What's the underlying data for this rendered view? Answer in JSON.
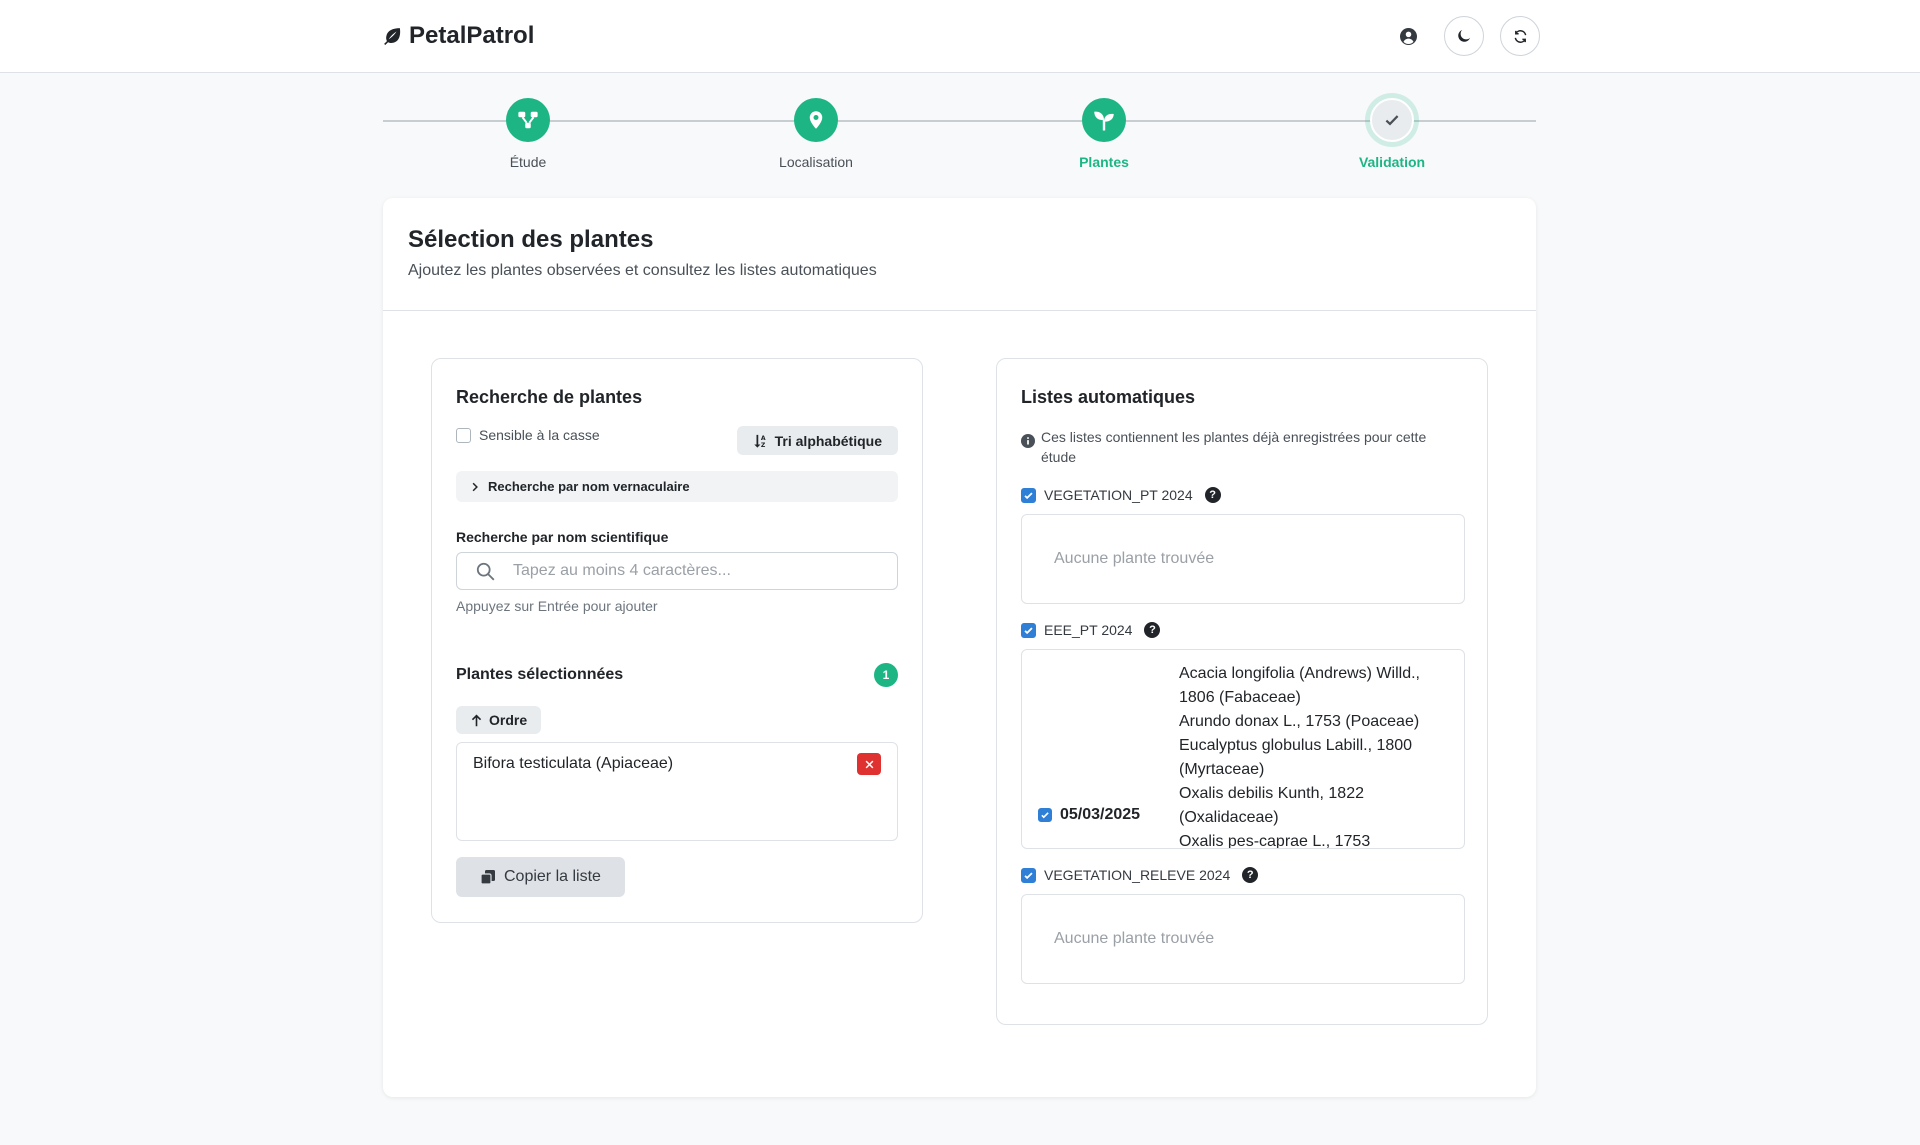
{
  "app": {
    "name": "PetalPatrol"
  },
  "stepper": [
    {
      "label": "Étude",
      "state": "done"
    },
    {
      "label": "Localisation",
      "state": "done"
    },
    {
      "label": "Plantes",
      "state": "active"
    },
    {
      "label": "Validation",
      "state": "active-pending"
    }
  ],
  "page": {
    "title": "Sélection des plantes",
    "subtitle": "Ajoutez les plantes observées et consultez les listes automatiques"
  },
  "search_panel": {
    "title": "Recherche de plantes",
    "case_sensitive_label": "Sensible à la casse",
    "case_sensitive_checked": false,
    "sort_label": "Tri alphabétique",
    "vernacular_toggle": "Recherche par nom vernaculaire",
    "scientific_label": "Recherche par nom scientifique",
    "scientific_placeholder": "Tapez au moins 4 caractères...",
    "hint": "Appuyez sur Entrée pour ajouter",
    "selected_title": "Plantes sélectionnées",
    "selected_count": "1",
    "order_label": "Ordre",
    "selected_items": [
      "Bifora testiculata (Apiaceae)"
    ],
    "copy_label": "Copier la liste"
  },
  "auto_lists": {
    "title": "Listes automatiques",
    "info": "Ces listes contiennent les plantes déjà enregistrées pour cette étude",
    "lists": [
      {
        "name": "VEGETATION_PT 2024",
        "checked": true,
        "empty_text": "Aucune plante trouvée"
      },
      {
        "name": "EEE_PT 2024",
        "checked": true,
        "date": "05/03/2025",
        "date_checked": true,
        "plants": [
          "Acacia longifolia (Andrews) Willd., 1806 (Fabaceae)",
          "Arundo donax L., 1753 (Poaceae)",
          "Eucalyptus globulus Labill., 1800 (Myrtaceae)",
          "Oxalis debilis Kunth, 1822 (Oxalidaceae)",
          "Oxalis pes-caprae L., 1753"
        ]
      },
      {
        "name": "VEGETATION_RELEVE 2024",
        "checked": true,
        "empty_text": "Aucune plante trouvée"
      }
    ]
  },
  "colors": {
    "accent": "#1db584",
    "checkbox": "#2f7fd6",
    "danger": "#e03131"
  }
}
